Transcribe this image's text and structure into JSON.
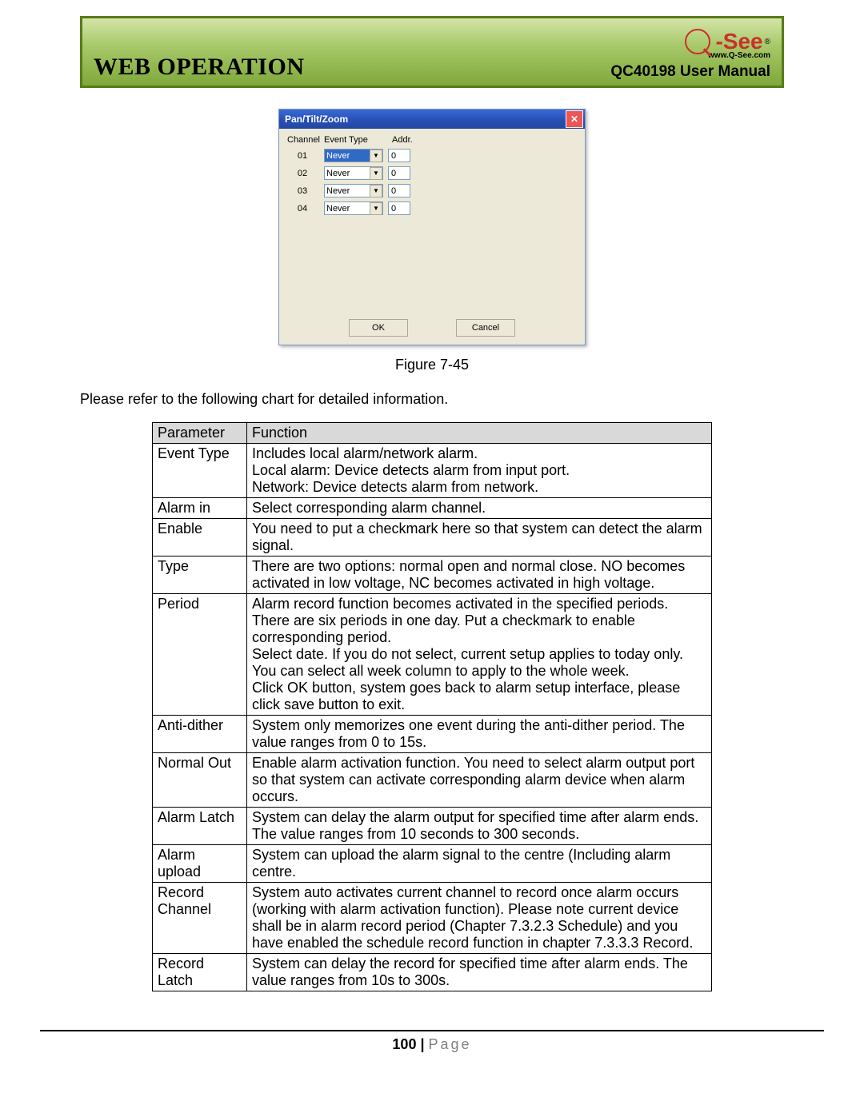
{
  "header": {
    "title": "WEB OPERATION",
    "product": "QC40198 User Manual",
    "logo_text": "-See",
    "logo_url": "www.Q-See.com",
    "logo_reg": "®"
  },
  "dialog": {
    "title": "Pan/Tilt/Zoom",
    "close_glyph": "✕",
    "headers": {
      "channel": "Channel",
      "event_type": "Event Type",
      "addr": "Addr."
    },
    "rows": [
      {
        "channel": "01",
        "event_type": "Never",
        "addr": "0",
        "selected": true
      },
      {
        "channel": "02",
        "event_type": "Never",
        "addr": "0",
        "selected": false
      },
      {
        "channel": "03",
        "event_type": "Never",
        "addr": "0",
        "selected": false
      },
      {
        "channel": "04",
        "event_type": "Never",
        "addr": "0",
        "selected": false
      }
    ],
    "ok": "OK",
    "cancel": "Cancel",
    "arrow": "▼"
  },
  "caption": "Figure 7-45",
  "intro": "Please refer to the following chart for detailed information.",
  "table": {
    "head": {
      "param": "Parameter",
      "func": "Function"
    },
    "rows": [
      {
        "param": "Event Type",
        "func": "Includes local alarm/network alarm.\nLocal alarm: Device detects alarm from input port.\nNetwork: Device detects alarm from network."
      },
      {
        "param": "Alarm in",
        "func": "Select corresponding alarm channel."
      },
      {
        "param": "Enable",
        "func": "You need to put a checkmark here so that system can detect the alarm signal."
      },
      {
        "param": "Type",
        "func": "There are two options: normal open and normal close. NO becomes activated in low voltage, NC becomes activated in high voltage."
      },
      {
        "param": "Period",
        "func": "Alarm record function becomes activated in the specified periods. There are six periods in one day. Put a checkmark to enable corresponding period.\nSelect date. If you do not select, current setup applies to today only. You can select all week column to apply to the whole week.\nClick OK button, system goes back to alarm setup interface, please click save button to exit."
      },
      {
        "param": "Anti-dither",
        "func": "System only memorizes one event during the anti-dither period. The value ranges from 0 to 15s."
      },
      {
        "param": "Normal Out",
        "func": "Enable alarm activation function. You need to select alarm output port so that system can activate corresponding alarm device when alarm occurs."
      },
      {
        "param": "Alarm Latch",
        "func": "System can delay the alarm output for specified time after alarm ends. The value ranges from 10 seconds to 300 seconds."
      },
      {
        "param": "Alarm upload",
        "func": "System can upload the alarm signal to the centre (Including alarm centre."
      },
      {
        "param": "Record Channel",
        "func": "System auto activates current channel to record once alarm occurs (working with alarm activation function). Please note current device shall be in alarm record period (Chapter 7.3.2.3 Schedule) and you have enabled the schedule record function in chapter 7.3.3.3 Record."
      },
      {
        "param": "Record Latch",
        "func": "System can delay the record for specified time after alarm ends. The value ranges from 10s to 300s."
      }
    ]
  },
  "footer": {
    "page_num": "100",
    "bar": " | ",
    "page_word": "Page"
  }
}
